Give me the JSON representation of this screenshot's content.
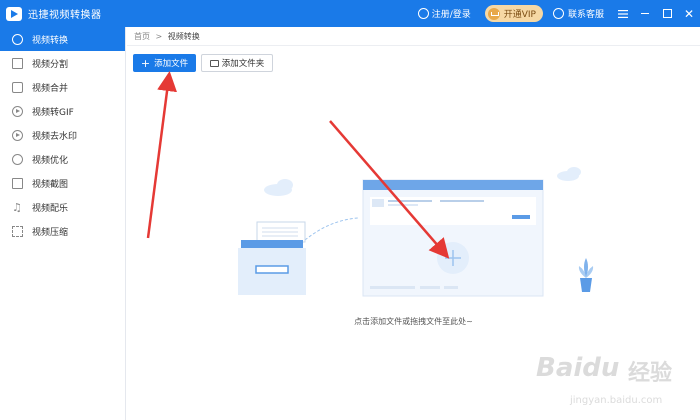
{
  "titlebar": {
    "app_title": "迅捷视频转换器",
    "login_label": "注册/登录",
    "vip_label": "开通VIP",
    "service_label": "联系客服",
    "menu_icon": "menu-icon",
    "minimize_icon": "minimize-icon",
    "maximize_icon": "maximize-icon",
    "close_icon": "close-icon"
  },
  "sidebar": {
    "items": [
      {
        "label": "视频转换",
        "icon": "convert-icon",
        "active": true
      },
      {
        "label": "视频分割",
        "icon": "split-icon"
      },
      {
        "label": "视频合并",
        "icon": "merge-icon"
      },
      {
        "label": "视频转GIF",
        "icon": "gif-icon"
      },
      {
        "label": "视频去水印",
        "icon": "watermark-remove-icon"
      },
      {
        "label": "视频优化",
        "icon": "optimize-icon"
      },
      {
        "label": "视频截图",
        "icon": "screenshot-icon"
      },
      {
        "label": "视频配乐",
        "icon": "music-icon"
      },
      {
        "label": "视频压缩",
        "icon": "compress-icon"
      }
    ]
  },
  "breadcrumb": {
    "home": "首页",
    "separator": ">",
    "current": "视频转换"
  },
  "toolbar": {
    "add_file_label": "添加文件",
    "add_folder_label": "添加文件夹"
  },
  "main": {
    "drop_hint": "点击添加文件或拖拽文件至此处~"
  },
  "watermark": {
    "brand": "Baidu",
    "brand_cn": "经验",
    "url": "jingyan.baidu.com"
  },
  "colors": {
    "accent": "#1a7ae8",
    "vip_bg": "#f6d8a4",
    "arrow": "#e53935"
  }
}
